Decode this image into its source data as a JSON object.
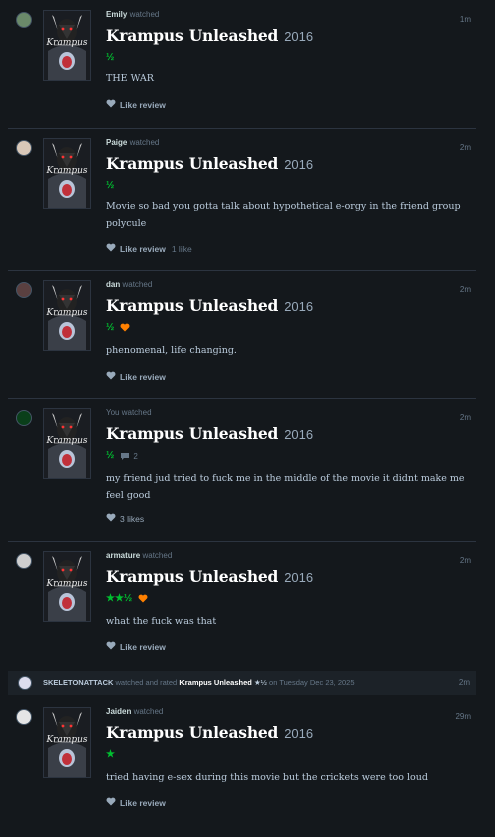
{
  "entries": [
    {
      "user": "Emily",
      "action": "watched",
      "time": "1m",
      "film": "Krampus Unleashed",
      "year": "2016",
      "stars": "½",
      "liked": false,
      "comments": "",
      "review": "THE WAR",
      "like_label": "Like review",
      "likes": ""
    },
    {
      "user": "Paige",
      "action": "watched",
      "time": "2m",
      "film": "Krampus Unleashed",
      "year": "2016",
      "stars": "½",
      "liked": false,
      "comments": "",
      "review": "Movie so bad you gotta talk about hypothetical e-orgy in the friend group polycule",
      "like_label": "Like review",
      "likes": "1 like"
    },
    {
      "user": "dan",
      "action": "watched",
      "time": "2m",
      "film": "Krampus Unleashed",
      "year": "2016",
      "stars": "½",
      "liked": true,
      "comments": "",
      "review": "phenomenal, life changing.",
      "like_label": "Like review",
      "likes": ""
    },
    {
      "user": "You",
      "action": "watched",
      "time": "2m",
      "film": "Krampus Unleashed",
      "year": "2016",
      "stars": "½",
      "liked": false,
      "comments": "2",
      "review": "my friend jud tried to fuck me in the middle of the movie it didnt make me feel good",
      "like_label": "",
      "likes": "3 likes"
    },
    {
      "user": "armature",
      "action": "watched",
      "time": "2m",
      "film": "Krampus Unleashed",
      "year": "2016",
      "stars": "★★½",
      "liked": true,
      "comments": "",
      "review": "what the fuck was that",
      "like_label": "Like review",
      "likes": ""
    },
    {
      "user": "Jaiden",
      "action": "watched",
      "time": "29m",
      "film": "Krampus Unleashed",
      "year": "2016",
      "stars": "★",
      "liked": false,
      "comments": "",
      "review": "tried having e-sex during this movie but the crickets were too loud",
      "like_label": "Like review",
      "likes": ""
    }
  ],
  "activity": {
    "user": "SKELETONATTACK",
    "middle": "watched and rated",
    "film": "Krampus Unleashed",
    "rating": "★½",
    "date_text": "on Tuesday Dec 23, 2025",
    "time": "2m"
  },
  "poster_text": "Krampus",
  "colors": {
    "bg": "#14181c",
    "star_green": "#00c030",
    "heart_orange": "#ff8000",
    "text_muted": "#678"
  }
}
